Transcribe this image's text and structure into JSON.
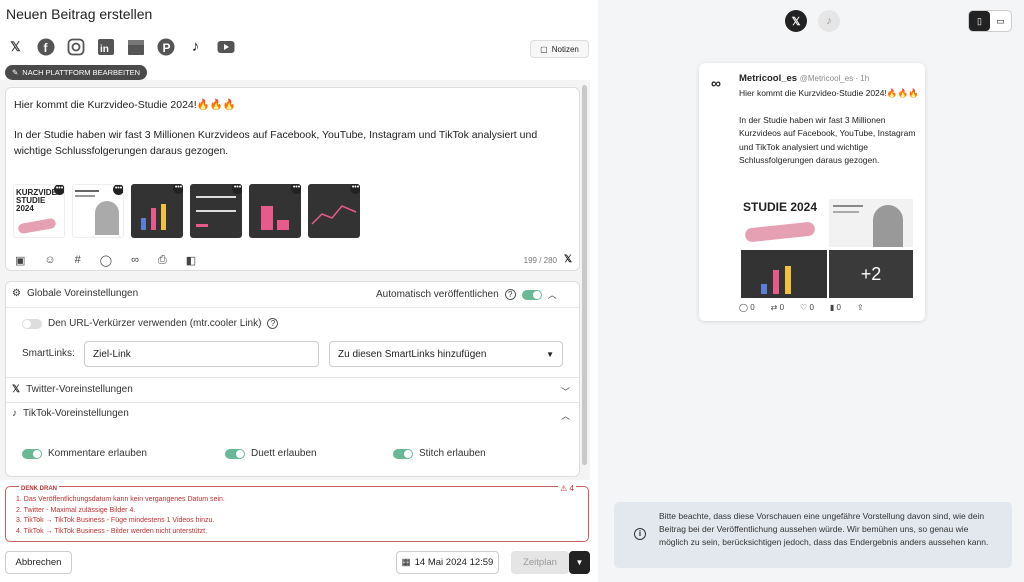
{
  "header": {
    "title": "Neuen Beitrag erstellen",
    "notes_label": "Notizen",
    "edit_platform_label": "NACH PLATTFORM BEARBEITEN"
  },
  "platforms": [
    "x-icon",
    "facebook-icon",
    "instagram-icon",
    "linkedin-icon",
    "google-business-icon",
    "pinterest-icon",
    "tiktok-icon",
    "youtube-icon"
  ],
  "editor": {
    "line1": "Hier kommt die Kurzvideo-Studie 2024!🔥🔥🔥",
    "line2": "In der Studie haben wir fast 3 Millionen Kurzvideos auf Facebook, YouTube, Instagram und TikTok analysiert und wichtige Schlussfolgerungen daraus gezogen.",
    "counter": "199 / 280",
    "thumb_title": "KURZVIDEO STUDIE 2024"
  },
  "settings": {
    "global_label": "Globale Voreinstellungen",
    "auto_publish_label": "Automatisch veröffentlichen",
    "url_shortener_label": "Den URL-Verkürzer verwenden (mtr.cooler Link)",
    "smartlinks_label": "SmartLinks:",
    "smartlinks_value": "Ziel-Link",
    "smartlinks_select": "Zu diesen SmartLinks hinzufügen",
    "twitter_label": "Twitter-Voreinstellungen",
    "tiktok_label": "TikTok-Voreinstellungen",
    "comments_label": "Kommentare erlauben",
    "duet_label": "Duett erlauben",
    "stitch_label": "Stitch erlauben"
  },
  "warnings": {
    "heading": "DENK DRAN",
    "count": "4",
    "items": [
      "1. Das Veröffentlichungsdatum kann kein vergangenes Datum sein.",
      "2. Twitter - Maximal zulässige Bilder 4.",
      "3. TikTok → TikTok Business - Füge mindestens 1 Videos hinzu.",
      "4. TikTok → TikTok Business - Bilder werden nicht unterstützt."
    ]
  },
  "footer": {
    "cancel_label": "Abbrechen",
    "date_label": "14 Mai 2024 12:59",
    "schedule_label": "Zeitplan"
  },
  "preview": {
    "name": "Metricool_es",
    "handle": "@Metricool_es · 1h",
    "line1": "Hier kommt die Kurzvideo-Studie 2024!🔥🔥🔥",
    "line2": "In der Studie haben wir fast 3 Millionen Kurzvideos auf Facebook, YouTube, Instagram und TikTok analysiert und wichtige Schlussfolgerungen daraus gezogen.",
    "img_title": "STUDIE 2024",
    "more_images": "+2",
    "reply": "0",
    "retweet": "0",
    "like": "0",
    "views": "0"
  },
  "note_text": "Bitte beachte, dass diese Vorschauen eine ungefähre Vorstellung davon sind, wie dein Beitrag bei der Veröffentlichung aussehen würde. Wir bemühen uns, so genau wie möglich zu sein, berücksichtigen jedoch, dass das Endergebnis anders aussehen kann.",
  "colors": {
    "toggle_on": "#69b896",
    "warning": "#c03030",
    "dark": "#222222"
  }
}
